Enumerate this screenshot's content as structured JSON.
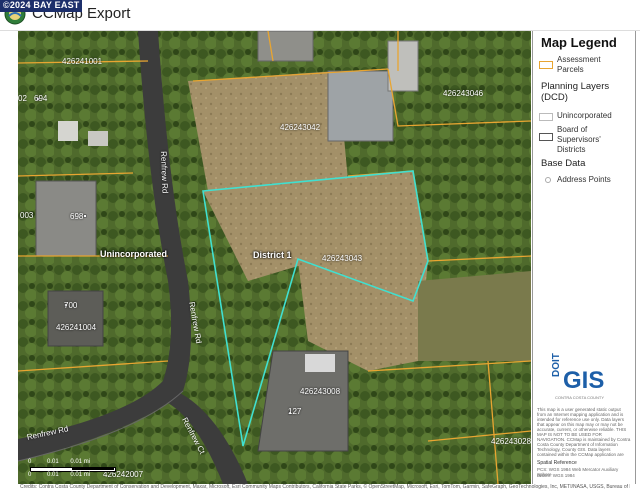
{
  "app": {
    "brand": "BAY EAST",
    "brand_prefix": "©2024",
    "title": "CCMap Export"
  },
  "map": {
    "parcels": [
      {
        "id": "426241001"
      },
      {
        "id": "426243046"
      },
      {
        "id": "426243042"
      },
      {
        "id": "426243043"
      },
      {
        "id": "426241004"
      },
      {
        "id": "426243008"
      },
      {
        "id": "426243028"
      },
      {
        "id": "426242007"
      }
    ],
    "address_points": [
      "694",
      "698",
      "003",
      "700",
      "127",
      "02"
    ],
    "streets": [
      "Renfrew Rd",
      "Renfrew Rd",
      "Renfrew Rd",
      "Renfrew Ct"
    ],
    "area_labels": [
      "Unincorporated",
      "District 1"
    ],
    "scale_bar": {
      "ticks": [
        "0",
        "0.01",
        "0.01 mi"
      ],
      "ticks_top": [
        "0",
        "0.01",
        "0.01 mi"
      ]
    }
  },
  "legend": {
    "title": "Map Legend",
    "assessment_parcels": "Assessment Parcels",
    "planning_layers": "Planning Layers (DCD)",
    "unincorporated": "Unincorporated",
    "board_districts": "Board of Supervisors' Districts",
    "base_data": "Base Data",
    "address_points": "Address Points",
    "doit_logo": "DOIT",
    "gis_logo": "GIS",
    "gis_sub": "CONTRA COSTA COUNTY",
    "disclaimer": "This map is a user generated static output from an Internet mapping application and is intended for reference use only. Data layers that appear on this map may or may not be accurate, current, or otherwise reliable. THIS MAP IS NOT TO BE USED FOR NAVIGATION. CCMap is maintained by Contra Costa County Department of Information Technology, County GIS. Data layers contained within the CCMap application are provided by various Contra Costa County Departments. Please direct all data inquiries to the appropriate department.",
    "spatial_reference": "Spatial Reference",
    "spatial_ref_detail": "PCS: WGS 1984 Web Mercator Auxiliary Sphere",
    "datum": "Datum: WGS 1984",
    "colors": {
      "parcel": "#e8a531",
      "unincorporated": "#bbbbbb",
      "district": "#555555"
    }
  },
  "footer": {
    "credit": "Credits: Contra Costa County Department of Conservation and Development, Maxar, Microsoft, Esri Community Maps Contributors, California State Parks, © OpenStreetMap, Microsoft, Esri, TomTom, Garmin, SafeGraph, GeoTechnologies, Inc, METI/NASA, USGS, Bureau of Land Management, EPA, NPS, US Census"
  }
}
